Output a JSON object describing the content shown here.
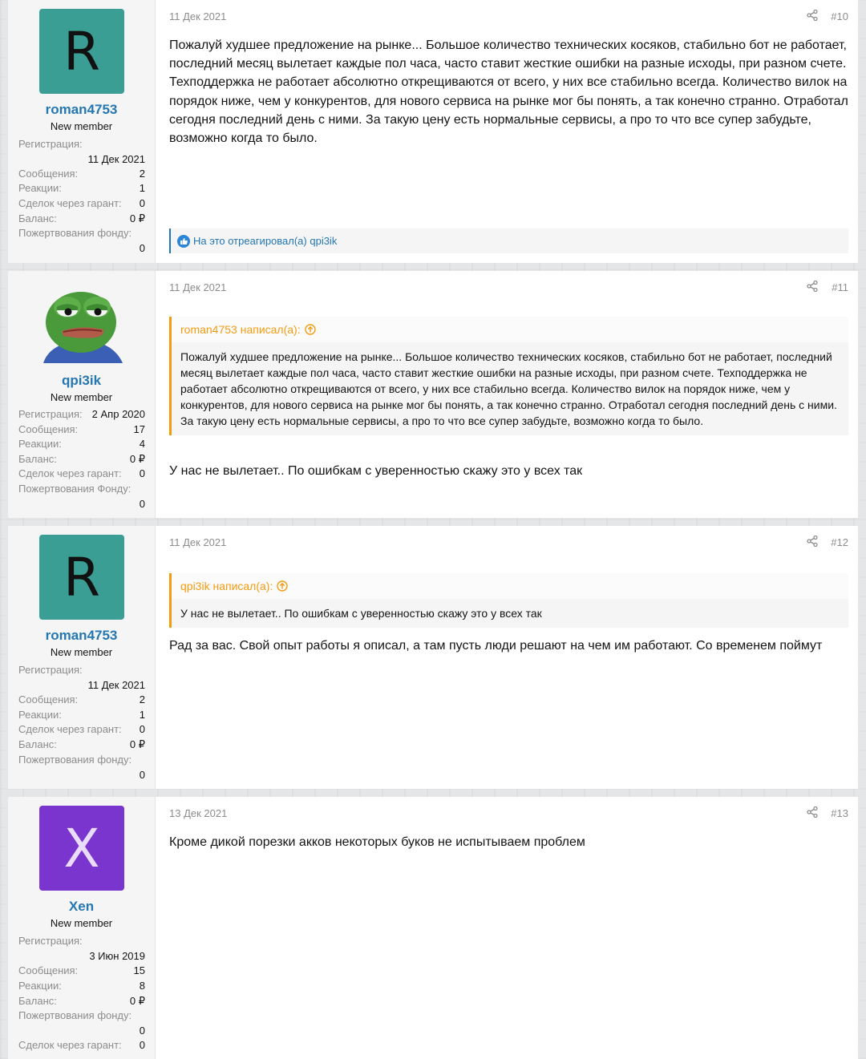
{
  "posts": [
    {
      "author": "roman4753",
      "avatar_letter": "R",
      "title": "New member",
      "date": "11 Дек 2021",
      "number": "#10",
      "stats": {
        "reg_label": "Регистрация:",
        "reg_value": "11 Дек 2021",
        "msg_label": "Сообщения:",
        "msg_value": "2",
        "react_label": "Реакции:",
        "react_value": "1",
        "deal_label": "Сделок через гарант:",
        "deal_value": "0",
        "bal_label": "Баланс:",
        "bal_value": "0 ₽",
        "don_label": "Пожертвования фонду:",
        "don_value": "0"
      },
      "text": "Пожалуй худшее предложение на рынке... Большое количество технических косяков, стабильно бот не работает, последний месяц вылетает каждые пол часа, часто ставит жесткие ошибки на разные исходы, при разном счете. Техподдержка не работает абсолютно открещиваются от всего, у них все стабильно всегда. Количество вилок на порядок ниже, чем у конкурентов, для нового сервиса на рынке мог бы понять, а так конечно странно. Отработал сегодня последний день с ними. За такую цену есть нормальные сервисы, а про то что все супер забудьте, возможно когда то было.",
      "reaction": "На это отреагировал(а) qpi3ik"
    },
    {
      "author": "qpi3ik",
      "title": "New member",
      "date": "11 Дек 2021",
      "number": "#11",
      "stats": {
        "reg_label": "Регистрация:",
        "reg_value": "2 Апр 2020",
        "msg_label": "Сообщения:",
        "msg_value": "17",
        "react_label": "Реакции:",
        "react_value": "4",
        "bal_label": "Баланс:",
        "bal_value": "0 ₽",
        "deal_label": "Сделок через гарант:",
        "deal_value": "0",
        "don_label": "Пожертвования Фонду:",
        "don_value": "0"
      },
      "quote_head": "roman4753 написал(а):",
      "quote_text": "Пожалуй худшее предложение на рынке... Большое количество технических косяков, стабильно бот не работает, последний месяц вылетает каждые пол часа, часто ставит жесткие ошибки на разные исходы, при разном счете. Техподдержка не работает абсолютно открещиваются от всего, у них все стабильно всегда. Количество вилок на порядок ниже, чем у конкурентов, для нового сервиса на рынке мог бы понять, а так конечно странно. Отработал сегодня последний день с ними. За такую цену есть нормальные сервисы, а про то что все супер забудьте, возможно когда то было.",
      "text": "У нас не вылетает.. По ошибкам с уверенностью скажу это у всех так"
    },
    {
      "author": "roman4753",
      "avatar_letter": "R",
      "title": "New member",
      "date": "11 Дек 2021",
      "number": "#12",
      "stats": {
        "reg_label": "Регистрация:",
        "reg_value": "11 Дек 2021",
        "msg_label": "Сообщения:",
        "msg_value": "2",
        "react_label": "Реакции:",
        "react_value": "1",
        "deal_label": "Сделок через гарант:",
        "deal_value": "0",
        "bal_label": "Баланс:",
        "bal_value": "0 ₽",
        "don_label": "Пожертвования фонду:",
        "don_value": "0"
      },
      "quote_head": "qpi3ik написал(а):",
      "quote_text": "У нас не вылетает.. По ошибкам с уверенностью скажу это у всех так",
      "text": "Рад за вас. Свой опыт работы я описал, а там пусть люди решают на чем им работают. Со временем поймут"
    },
    {
      "author": "Xen",
      "avatar_letter": "X",
      "title": "New member",
      "date": "13 Дек 2021",
      "number": "#13",
      "stats": {
        "reg_label": "Регистрация:",
        "reg_value": "3 Июн 2019",
        "msg_label": "Сообщения:",
        "msg_value": "15",
        "react_label": "Реакции:",
        "react_value": "8",
        "bal_label": "Баланс:",
        "bal_value": "0 ₽",
        "don_label": "Пожертвования фонду:",
        "don_value": "0",
        "deal_label": "Сделок через гарант:",
        "deal_value": "0"
      },
      "text": "Кроме дикой порезки акков некоторых буков не испытываем проблем"
    }
  ],
  "colors": {
    "username": "#2577b1",
    "quote_accent": "#f39c12",
    "avatar_teal": "#3b9e94",
    "avatar_purple": "#7b35cf"
  },
  "icons": {
    "share": "share-icon",
    "quote_up": "arrow-up-circle-icon",
    "like": "thumbs-up-icon"
  }
}
